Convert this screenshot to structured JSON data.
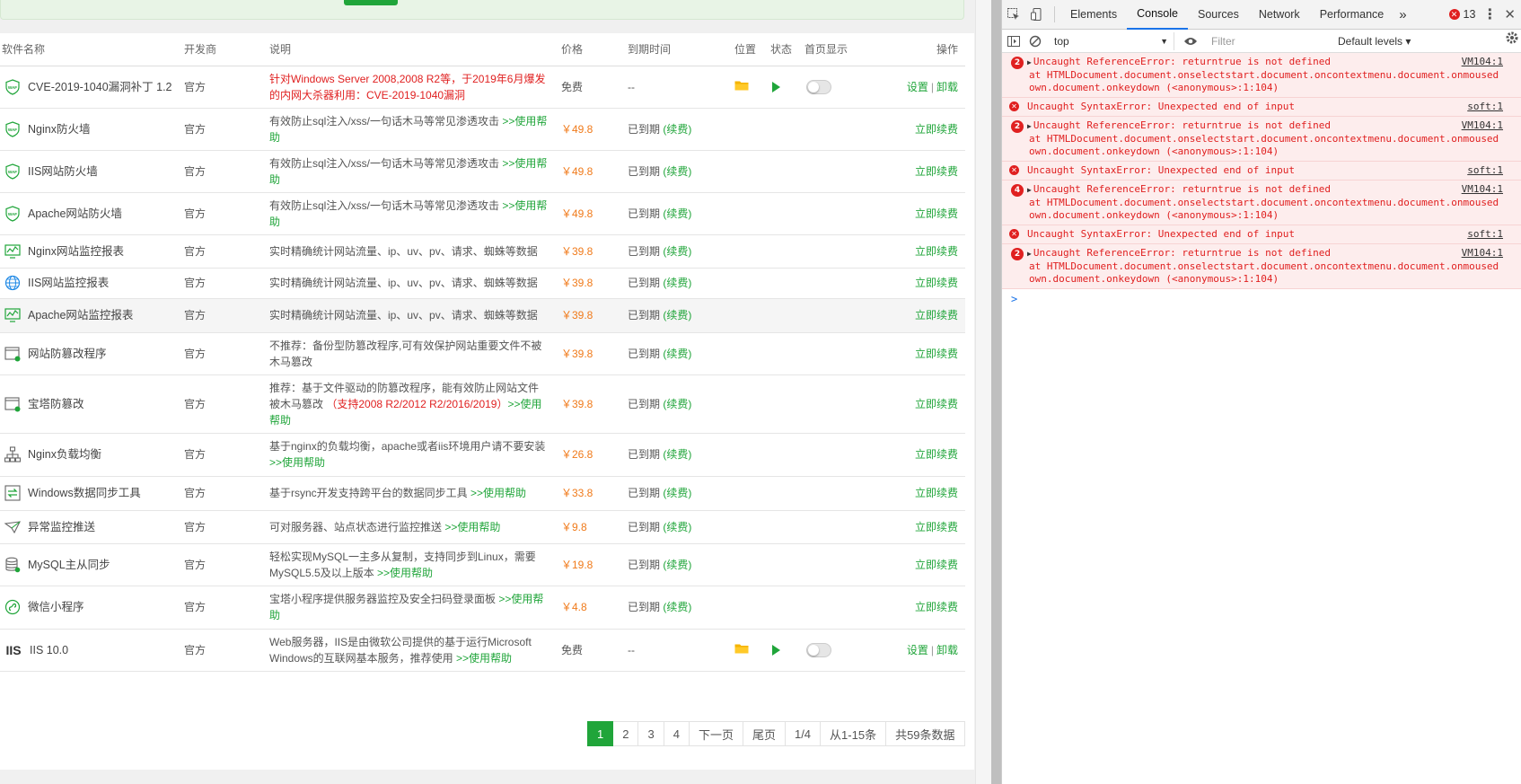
{
  "table": {
    "headers": {
      "name": "软件名称",
      "developer": "开发商",
      "desc": "说明",
      "price": "价格",
      "expire": "到期时间",
      "position": "位置",
      "status": "状态",
      "home": "首页显示",
      "ops": "操作"
    },
    "rows": [
      {
        "icon": "waf-shield-icon",
        "name": "CVE-2019-1040漏洞补丁 1.2",
        "dev": "官方",
        "desc_main": "针对Windows Server 2008,2008 R2等，于2019年6月爆发的内网大杀器利用：CVE-2019-1040漏洞",
        "desc_link": "",
        "desc_red": "",
        "desc_tail": "",
        "red_main": true,
        "price": "免费",
        "free": true,
        "expire": "--",
        "renew": "",
        "installed": true,
        "op1": "设置",
        "op2": "卸载"
      },
      {
        "icon": "waf-shield-icon",
        "name": "Nginx防火墙",
        "dev": "官方",
        "desc_main": "有效防止sql注入/xss/一句话木马等常见渗透攻击 ",
        "desc_link": ">>使用帮助",
        "desc_red": "",
        "desc_tail": "",
        "price": "￥49.8",
        "expire": "已到期 ",
        "renew": "(续费)",
        "op": "立即续费"
      },
      {
        "icon": "waf-shield-icon",
        "name": "IIS网站防火墙",
        "dev": "官方",
        "desc_main": "有效防止sql注入/xss/一句话木马等常见渗透攻击 ",
        "desc_link": ">>使用帮助",
        "desc_red": "",
        "desc_tail": "",
        "price": "￥49.8",
        "expire": "已到期 ",
        "renew": "(续费)",
        "op": "立即续费"
      },
      {
        "icon": "waf-shield-icon",
        "name": "Apache网站防火墙",
        "dev": "官方",
        "desc_main": "有效防止sql注入/xss/一句话木马等常见渗透攻击 ",
        "desc_link": ">>使用帮助",
        "desc_red": "",
        "desc_tail": "",
        "price": "￥49.8",
        "expire": "已到期 ",
        "renew": "(续费)",
        "op": "立即续费"
      },
      {
        "icon": "monitor-chart-icon",
        "name": "Nginx网站监控报表",
        "dev": "官方",
        "desc_main": "实时精确统计网站流量、ip、uv、pv、请求、蜘蛛等数据",
        "desc_link": "",
        "desc_red": "",
        "desc_tail": "",
        "price": "￥39.8",
        "expire": "已到期 ",
        "renew": "(续费)",
        "op": "立即续费"
      },
      {
        "icon": "globe-icon",
        "name": "IIS网站监控报表",
        "dev": "官方",
        "desc_main": "实时精确统计网站流量、ip、uv、pv、请求、蜘蛛等数据",
        "desc_link": "",
        "desc_red": "",
        "desc_tail": "",
        "price": "￥39.8",
        "expire": "已到期 ",
        "renew": "(续费)",
        "op": "立即续费"
      },
      {
        "icon": "monitor-chart-icon",
        "name": "Apache网站监控报表",
        "dev": "官方",
        "desc_main": "实时精确统计网站流量、ip、uv、pv、请求、蜘蛛等数据",
        "desc_link": "",
        "desc_red": "",
        "desc_tail": "",
        "price": "￥39.8",
        "expire": "已到期 ",
        "renew": "(续费)",
        "op": "立即续费",
        "highlight": true
      },
      {
        "icon": "window-lock-icon",
        "name": "网站防篡改程序",
        "dev": "官方",
        "desc_main": "不推荐：备份型防篡改程序,可有效保护网站重要文件不被木马篡改",
        "desc_link": "",
        "desc_red": "",
        "desc_tail": "",
        "price": "￥39.8",
        "expire": "已到期 ",
        "renew": "(续费)",
        "op": "立即续费"
      },
      {
        "icon": "window-lock-icon",
        "name": "宝塔防篡改",
        "dev": "官方",
        "desc_main": "推荐：基于文件驱动的防篡改程序，能有效防止网站文件被木马篡改 ",
        "desc_red": "（支持2008 R2/2012 R2/2016/2019）",
        "desc_link": ">>使用帮助",
        "desc_tail": "",
        "price": "￥39.8",
        "expire": "已到期 ",
        "renew": "(续费)",
        "op": "立即续费"
      },
      {
        "icon": "network-tree-icon",
        "name": "Nginx负载均衡",
        "dev": "官方",
        "desc_main": "基于nginx的负载均衡，apache或者iis环境用户请不要安装 ",
        "desc_link": ">>使用帮助",
        "desc_red": "",
        "desc_tail": "",
        "price": "￥26.8",
        "expire": "已到期 ",
        "renew": "(续费)",
        "op": "立即续费"
      },
      {
        "icon": "sync-icon",
        "name": "Windows数据同步工具",
        "dev": "官方",
        "desc_main": "基于rsync开发支持跨平台的数据同步工具 ",
        "desc_link": ">>使用帮助",
        "desc_red": "",
        "desc_tail": "",
        "price": "￥33.8",
        "expire": "已到期 ",
        "renew": "(续费)",
        "op": "立即续费"
      },
      {
        "icon": "send-icon",
        "name": "异常监控推送",
        "dev": "官方",
        "desc_main": "可对服务器、站点状态进行监控推送 ",
        "desc_link": ">>使用帮助",
        "desc_red": "",
        "desc_tail": "",
        "price": "￥9.8",
        "expire": "已到期 ",
        "renew": "(续费)",
        "op": "立即续费"
      },
      {
        "icon": "database-icon",
        "name": "MySQL主从同步",
        "dev": "官方",
        "desc_main": "轻松实现MySQL一主多从复制，支持同步到Linux，需要MySQL5.5及以上版本 ",
        "desc_link": ">>使用帮助",
        "desc_red": "",
        "desc_tail": "",
        "price": "￥19.8",
        "expire": "已到期 ",
        "renew": "(续费)",
        "op": "立即续费"
      },
      {
        "icon": "wechat-mini-icon",
        "name": "微信小程序",
        "dev": "官方",
        "desc_main": "宝塔小程序提供服务器监控及安全扫码登录面板 ",
        "desc_link": ">>使用帮助",
        "desc_red": "",
        "desc_tail": "",
        "price": "￥4.8",
        "expire": "已到期 ",
        "renew": "(续费)",
        "op": "立即续费"
      },
      {
        "icon": "iis-text-icon",
        "icon_text": "IIS",
        "name": "IIS 10.0",
        "dev": "官方",
        "desc_main": "Web服务器，IIS是由微软公司提供的基于运行Microsoft Windows的互联网基本服务，推荐使用 ",
        "desc_link": ">>使用帮助",
        "desc_red": "",
        "desc_tail": "",
        "price": "免费",
        "free": true,
        "expire": "--",
        "renew": "",
        "installed": true,
        "op1": "设置",
        "op2": "卸载"
      }
    ]
  },
  "pager": {
    "pages": [
      "1",
      "2",
      "3",
      "4"
    ],
    "current": "1",
    "next": "下一页",
    "last": "尾页",
    "ratio": "1/4",
    "range": "从1-15条",
    "total": "共59条数据"
  },
  "devtools": {
    "tabs": [
      "Elements",
      "Console",
      "Sources",
      "Network",
      "Performance"
    ],
    "active_tab": "Console",
    "more": "»",
    "error_count": "13",
    "context": "top",
    "filter_placeholder": "Filter",
    "levels": "Default levels ▾",
    "messages": [
      {
        "type": "grouped",
        "count": "2",
        "text": "Uncaught ReferenceError: returntrue is not defined",
        "src": "VM104:1",
        "stack": "    at HTMLDocument.document.onselectstart.document.oncontextmenu.document.onmousedown.document.onkeydown (<anonymous>:1:104)"
      },
      {
        "type": "single",
        "text": "Uncaught SyntaxError: Unexpected end of input",
        "src": "soft:1"
      },
      {
        "type": "grouped",
        "count": "2",
        "text": "Uncaught ReferenceError: returntrue is not defined",
        "src": "VM104:1",
        "stack": "    at HTMLDocument.document.onselectstart.document.oncontextmenu.document.onmousedown.document.onkeydown (<anonymous>:1:104)"
      },
      {
        "type": "single",
        "text": "Uncaught SyntaxError: Unexpected end of input",
        "src": "soft:1"
      },
      {
        "type": "grouped",
        "count": "4",
        "text": "Uncaught ReferenceError: returntrue is not defined",
        "src": "VM104:1",
        "stack": "    at HTMLDocument.document.onselectstart.document.oncontextmenu.document.onmousedown.document.onkeydown (<anonymous>:1:104)"
      },
      {
        "type": "single",
        "text": "Uncaught SyntaxError: Unexpected end of input",
        "src": "soft:1"
      },
      {
        "type": "grouped",
        "count": "2",
        "text": "Uncaught ReferenceError: returntrue is not defined",
        "src": "VM104:1",
        "stack": "    at HTMLDocument.document.onselectstart.document.oncontextmenu.document.onmousedown.document.onkeydown (<anonymous>:1:104)"
      }
    ],
    "prompt": ">"
  },
  "colors": {
    "accent_green": "#20a53a",
    "price_orange": "#f07a1a",
    "error_red": "#e02020",
    "chrome_blue": "#1a73e8"
  }
}
